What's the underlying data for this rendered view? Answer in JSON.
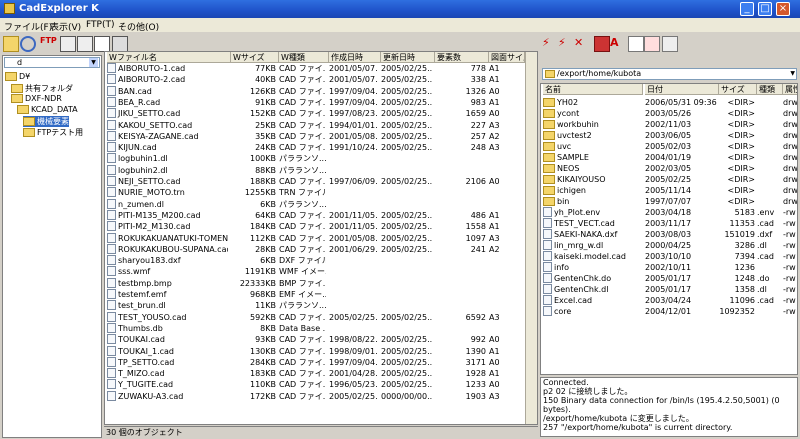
{
  "window": {
    "title": "CadExplorer K"
  },
  "menu": [
    "ファイル(F)",
    "表示(V)",
    "FTP(T)",
    "その他(O)"
  ],
  "left_tree": {
    "drive": "d",
    "items": [
      {
        "label": "D¥",
        "indent": 0
      },
      {
        "label": "共有フォルダ",
        "indent": 1
      },
      {
        "label": "DXF-NDR",
        "indent": 1
      },
      {
        "label": "KCAD_DATA",
        "indent": 2
      },
      {
        "label": "機械要素",
        "indent": 3,
        "selected": true
      },
      {
        "label": "FTPテスト用",
        "indent": 3
      }
    ]
  },
  "local_headers": [
    "Wファイル名",
    "Wサイズ",
    "W種類",
    "作成日時",
    "更新日時",
    "要素数",
    "図面サイズ"
  ],
  "local_files": [
    [
      "AIBORUTO-1.cad",
      "77KB",
      "CAD ファイ...",
      "2001/05/07...",
      "2005/02/25...",
      "778",
      "A1"
    ],
    [
      "AIBORUTO-2.cad",
      "40KB",
      "CAD ファイ...",
      "2001/05/07...",
      "2005/02/25...",
      "338",
      "A1"
    ],
    [
      "BAN.cad",
      "126KB",
      "CAD ファイ...",
      "1997/09/04...",
      "2005/02/25...",
      "1326",
      "A0"
    ],
    [
      "BEA_R.cad",
      "91KB",
      "CAD ファイ...",
      "1997/09/04...",
      "2005/02/25...",
      "983",
      "A1"
    ],
    [
      "JIKU_SETTO.cad",
      "152KB",
      "CAD ファイ...",
      "1997/08/23...",
      "2005/02/25...",
      "1659",
      "A0"
    ],
    [
      "KAKOU_SETTO.cad",
      "25KB",
      "CAD ファイ...",
      "1994/01/01...",
      "2005/02/25...",
      "227",
      "A3"
    ],
    [
      "KEISYA-ZAGANE.cad",
      "35KB",
      "CAD ファイ...",
      "2001/05/08...",
      "2005/02/25...",
      "257",
      "A2"
    ],
    [
      "KIJUN.cad",
      "24KB",
      "CAD ファイ...",
      "1991/10/24...",
      "2005/02/25...",
      "248",
      "A3"
    ],
    [
      "logbuhin1.dl",
      "100KB",
      "パラランソ...",
      "",
      "",
      "",
      ""
    ],
    [
      "logbuhin2.dl",
      "88KB",
      "パラランソ...",
      "",
      "",
      "",
      ""
    ],
    [
      "NEJI_SETTO.cad",
      "188KB",
      "CAD ファイ...",
      "1997/06/09...",
      "2005/02/25...",
      "2106",
      "A0"
    ],
    [
      "NURIE_MOTO.trn",
      "1255KB",
      "TRN ファイル",
      "",
      "",
      "",
      ""
    ],
    [
      "n_zumen.dl",
      "6KB",
      "パラランソ...",
      "",
      "",
      "",
      ""
    ],
    [
      "PITI-M135_M200.cad",
      "64KB",
      "CAD ファイ...",
      "2001/11/05...",
      "2005/02/25...",
      "486",
      "A1"
    ],
    [
      "PITI-M2_M130.cad",
      "184KB",
      "CAD ファイ...",
      "2001/11/05...",
      "2005/02/25...",
      "1558",
      "A1"
    ],
    [
      "ROKUKAKUANATUKI-TOMENE...",
      "112KB",
      "CAD ファイ...",
      "2001/05/08...",
      "2005/02/25...",
      "1097",
      "A3"
    ],
    [
      "ROKUKAKUBOU-SUPANA.cad",
      "28KB",
      "CAD ファイ...",
      "2001/06/29...",
      "2005/02/25...",
      "241",
      "A2"
    ],
    [
      "sharyou183.dxf",
      "6KB",
      "DXF ファイル",
      "",
      "",
      "",
      ""
    ],
    [
      "sss.wmf",
      "1191KB",
      "WMF イメー...",
      "",
      "",
      "",
      ""
    ],
    [
      "testbmp.bmp",
      "22333KB",
      "BMP ファイ...",
      "",
      "",
      "",
      ""
    ],
    [
      "testemf.emf",
      "968KB",
      "EMF イメー...",
      "",
      "",
      "",
      ""
    ],
    [
      "test_brun.dl",
      "11KB",
      "パラランソ...",
      "",
      "",
      "",
      ""
    ],
    [
      "TEST_YOUSO.cad",
      "592KB",
      "CAD ファイ...",
      "2005/02/25...",
      "2005/02/25...",
      "6592",
      "A3"
    ],
    [
      "Thumbs.db",
      "8KB",
      "Data Base ...",
      "",
      "",
      "",
      ""
    ],
    [
      "TOUKAI.cad",
      "93KB",
      "CAD ファイ...",
      "1998/08/22...",
      "2005/02/25...",
      "992",
      "A0"
    ],
    [
      "TOUKAI_1.cad",
      "130KB",
      "CAD ファイ...",
      "1998/09/01...",
      "2005/02/25...",
      "1390",
      "A1"
    ],
    [
      "TP_SETTO.cad",
      "284KB",
      "CAD ファイ...",
      "1997/09/04...",
      "2005/02/25...",
      "3171",
      "A0"
    ],
    [
      "T_MIZO.cad",
      "183KB",
      "CAD ファイ...",
      "2001/04/28...",
      "2005/02/25...",
      "1928",
      "A1"
    ],
    [
      "Y_TUGITE.cad",
      "110KB",
      "CAD ファイ...",
      "1996/05/23...",
      "2005/02/25...",
      "1233",
      "A0"
    ],
    [
      "ZUWAKU-A3.cad",
      "172KB",
      "CAD ファイ...",
      "2005/02/25...",
      "0000/00/00...",
      "1903",
      "A3"
    ]
  ],
  "status_text": "30 個のオブジェクト",
  "remote": {
    "path": "/export/home/kubota",
    "headers": [
      "名前",
      "日付",
      "サイズ",
      "種類",
      "属性"
    ],
    "files": [
      [
        "YH02",
        "2006/05/31 09:36",
        "<DIR>",
        "",
        "drw"
      ],
      [
        "ycont",
        "2003/05/26",
        "<DIR>",
        "",
        "drw"
      ],
      [
        "workbuhin",
        "2002/11/03",
        "<DIR>",
        "",
        "drw"
      ],
      [
        "uvctest2",
        "2003/06/05",
        "<DIR>",
        "",
        "drw"
      ],
      [
        "uvc",
        "2005/02/03",
        "<DIR>",
        "",
        "drw"
      ],
      [
        "SAMPLE",
        "2004/01/19",
        "<DIR>",
        "",
        "drw"
      ],
      [
        "NEOS",
        "2002/03/05",
        "<DIR>",
        "",
        "drw"
      ],
      [
        "KIKAIYOUSO",
        "2005/02/25",
        "<DIR>",
        "",
        "drw"
      ],
      [
        "ichigen",
        "2005/11/14",
        "<DIR>",
        "",
        "drw"
      ],
      [
        "bin",
        "1997/07/07",
        "<DIR>",
        "",
        "drw"
      ],
      [
        "yh_Plot.env",
        "2003/04/18",
        "5183",
        ".env",
        "-rw"
      ],
      [
        "TEST_VECT.cad",
        "2003/11/17",
        "11353",
        ".cad",
        "-rw"
      ],
      [
        "SAEKI-NAKA.dxf",
        "2003/08/03",
        "151019",
        ".dxf",
        "-rw"
      ],
      [
        "lin_mrg_w.dl",
        "2000/04/25",
        "3286",
        ".dl",
        "-rw"
      ],
      [
        "kaiseki.model.cad",
        "2003/10/10",
        "7394",
        ".cad",
        "-rw"
      ],
      [
        "info",
        "2002/10/11",
        "1236",
        "",
        "-rw"
      ],
      [
        "GentenChk.do",
        "2005/01/17",
        "1248",
        ".do",
        "-rw"
      ],
      [
        "GentenChk.dl",
        "2005/01/17",
        "1358",
        ".dl",
        "-rw"
      ],
      [
        "Excel.cad",
        "2003/04/24",
        "11096",
        ".cad",
        "-rw"
      ],
      [
        "core",
        "2004/12/01",
        "1092352",
        "",
        "-rw"
      ]
    ]
  },
  "log_lines": [
    "Connected.",
    "p2 02 に接続しました。",
    "150 Binary data connection for /bin/ls (195.4.2.50,5001) (0 bytes).",
    "/export/home/kubota に変更しました。",
    "257 \"/export/home/kubota\" is current directory."
  ],
  "colors": {
    "title": "#1f52c9",
    "selection": "#316ac5",
    "folder": "#f4d56a"
  }
}
